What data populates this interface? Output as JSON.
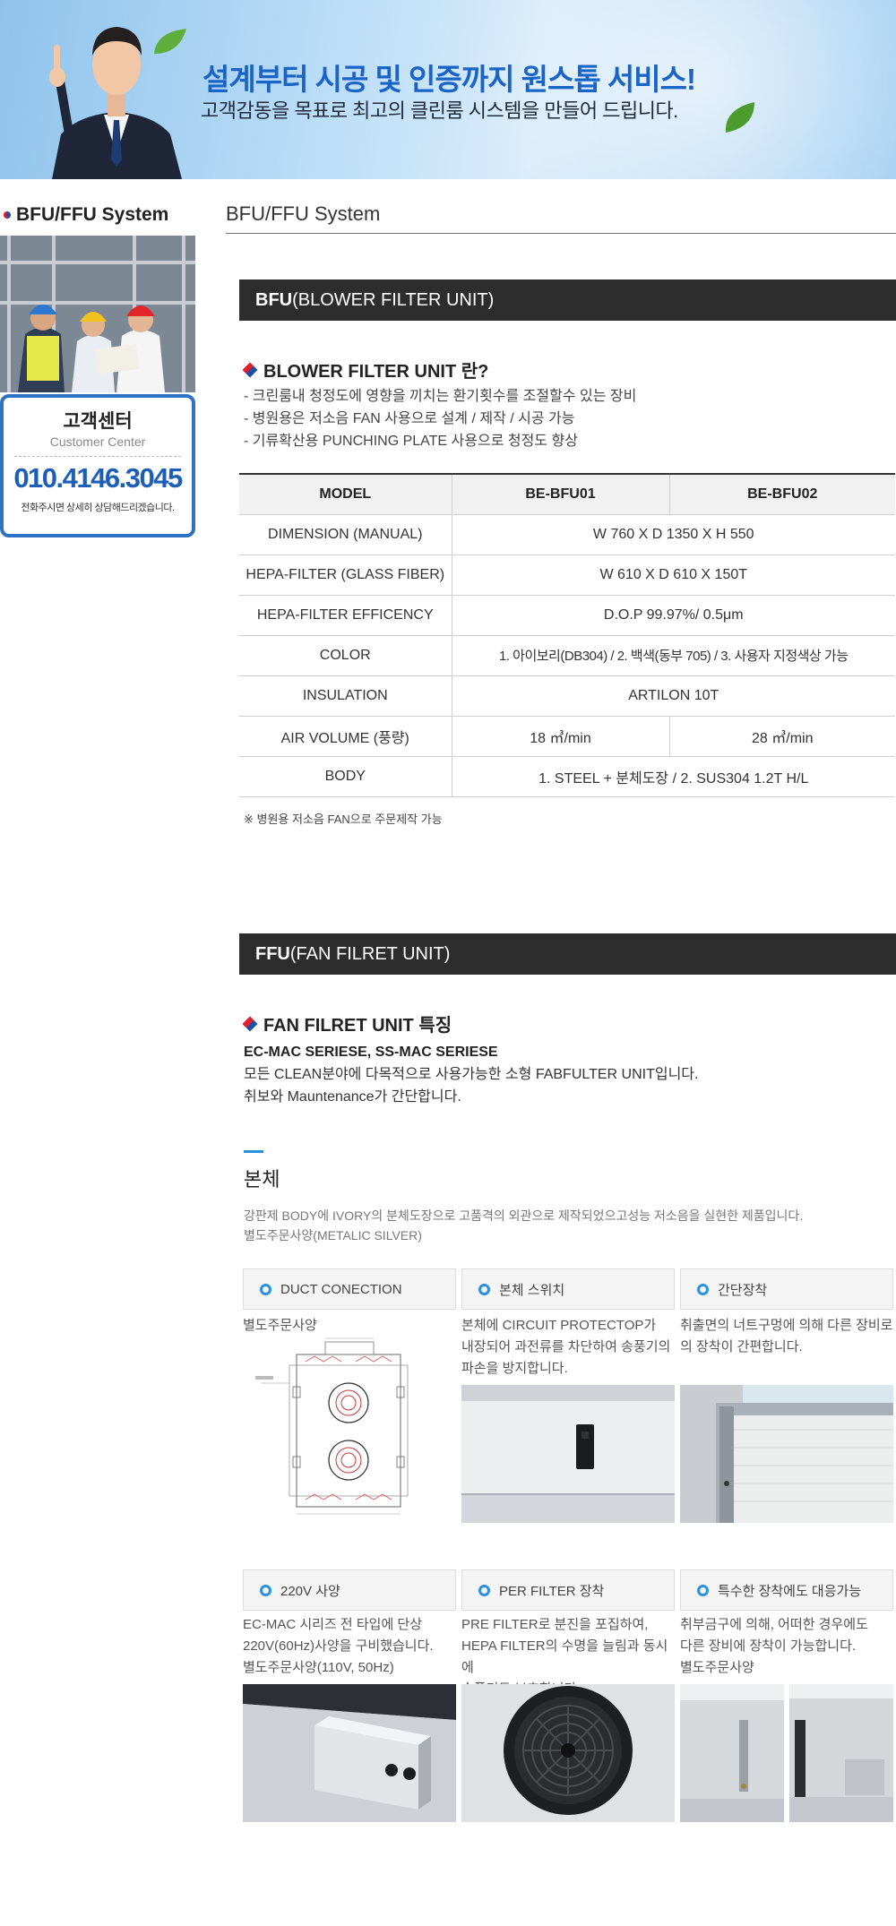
{
  "banner": {
    "title": "설계부터 시공 및 인증까지 원스톱 서비스!",
    "subtitle": "고객감동을 목표로 최고의 클린룸 시스템을 만들어 드립니다."
  },
  "sidebar": {
    "title": "BFU/FFU System",
    "customer_center": {
      "title": "고객센터",
      "subtitle": "Customer Center",
      "phone": "010.4146.3045",
      "note": "전화주시면 상세히 상담해드리겠습니다."
    }
  },
  "page": {
    "title": "BFU/FFU System"
  },
  "bfu": {
    "bar_bold": "BFU",
    "bar_text": "(BLOWER FILTER UNIT)",
    "heading": "BLOWER FILTER UNIT 란?",
    "bullets": [
      "- 크린룸내 청정도에 영향을 끼치는 환기횟수를 조절할수 있는 장비",
      "- 병원용은 저소음 FAN 사용으로 설계 / 제작 / 시공 가능",
      "- 기류확산용 PUNCHING PLATE 사용으로 청정도 향상"
    ],
    "table": {
      "headers": [
        "MODEL",
        "BE-BFU01",
        "BE-BFU02"
      ],
      "rows": [
        {
          "label": "DIMENSION (MANUAL)",
          "value": "W 760 X D 1350 X H 550"
        },
        {
          "label": "HEPA-FILTER (GLASS FIBER)",
          "value": "W 610 X D 610 X 150T"
        },
        {
          "label": "HEPA-FILTER EFFICENCY",
          "value": "D.O.P 99.97%/ 0.5μm"
        },
        {
          "label": "COLOR",
          "value": "1. 아이보리(DB304) / 2. 백색(동부 705) / 3. 사용자 지정색상 가능"
        },
        {
          "label": "INSULATION",
          "value": "ARTILON 10T"
        },
        {
          "label": "AIR VOLUME (풍량)",
          "value1": "18 ㎥/min",
          "value2": "28 ㎥/min"
        },
        {
          "label": "BODY",
          "value": "1. STEEL + 분체도장 / 2. SUS304 1.2T H/L"
        }
      ]
    },
    "note": "※ 병원용 저소음 FAN으로 주문제작 가능"
  },
  "ffu": {
    "bar_bold": "FFU",
    "bar_text": "(FAN FILRET UNIT)",
    "heading": "FAN FILRET UNIT 특징",
    "lines": [
      "EC-MAC SERIESE, SS-MAC SERIESE",
      "모든 CLEAN분야에 다목적으로 사용가능한 소형 FABFULTER UNIT입니다.",
      "취보와 Mauntenance가 간단합니다."
    ],
    "body_title": "본체",
    "body_desc": [
      "강판제 BODY에 IVORY의 분체도장으로 고품격의 외관으로 제작되었으고성능 저소음을 실현한 제품입니다.",
      "별도주문사양(METALIC SILVER)"
    ],
    "features": [
      {
        "label": "DUCT CONECTION",
        "text": [
          "별도주문사양"
        ]
      },
      {
        "label": "본체 스위치",
        "text": [
          "본체에 CIRCUIT PROTECTOP가",
          "내장되어 과전류를 차단하여 송풍기의",
          "파손을 방지합니다."
        ]
      },
      {
        "label": "간단장착",
        "text": [
          "취출면의 너트구멍에 의해 다른 장비로",
          "의 장착이 간편합니다."
        ]
      },
      {
        "label": "220V 사양",
        "text": [
          "EC-MAC 시리즈 전 타입에 단상",
          "220V(60Hz)사양을 구비했습니다.",
          "별도주문사양(110V, 50Hz)"
        ]
      },
      {
        "label": "PER FILTER 장착",
        "text": [
          "PRE FILTER로 분진을 포집하여,",
          "HEPA FILTER의 수명을 늘림과 동시에",
          "송풍기도 보호합니다."
        ]
      },
      {
        "label": "특수한 장착에도 대응가능",
        "text": [
          "취부금구에 의해, 어떠한 경우에도",
          "다른 장비에 장착이 가능합니다.",
          "별도주문사양"
        ]
      }
    ]
  }
}
